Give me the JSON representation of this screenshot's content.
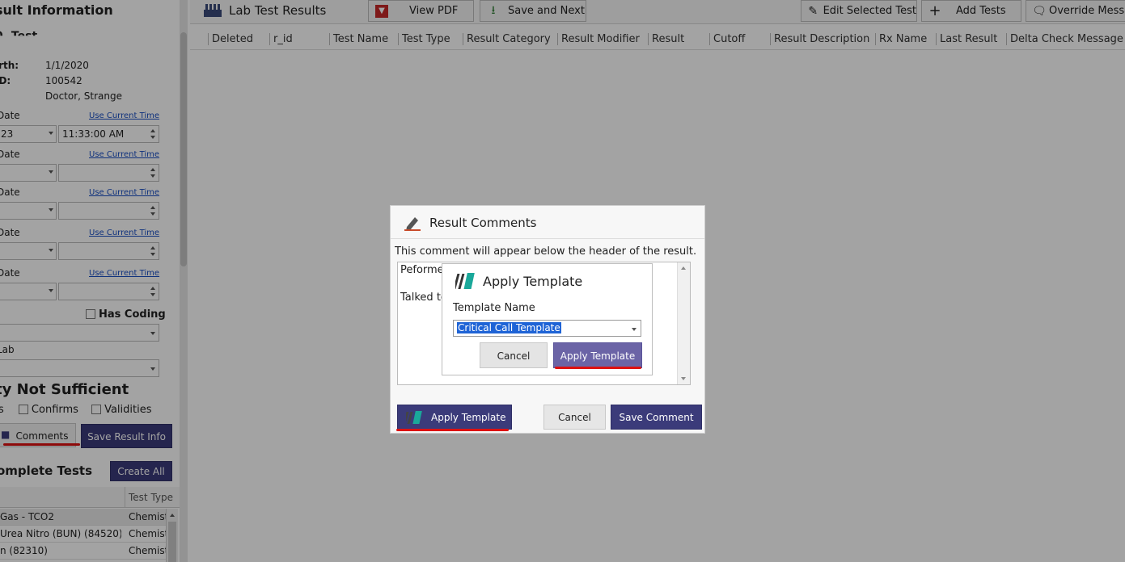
{
  "left_panel": {
    "title": "sult Information",
    "subtitle": "0. Test",
    "info": [
      {
        "key": "irth:",
        "value": "1/1/2020"
      },
      {
        "key": " ID:",
        "value": "100542"
      },
      {
        "key": ":",
        "value": "Doctor, Strange"
      }
    ],
    "dates": [
      {
        "label": "Date",
        "link": "Use Current Time",
        "date_value": "23",
        "time_value": "11:33:00 AM"
      },
      {
        "label": "Date",
        "link": "Use Current Time",
        "date_value": "",
        "time_value": ""
      },
      {
        "label": " Date",
        "link": "Use Current Time",
        "date_value": "",
        "time_value": ""
      },
      {
        "label": " Date",
        "link": "Use Current Time",
        "date_value": "",
        "time_value": ""
      },
      {
        "label": " Date",
        "link": "Use Current Time",
        "date_value": "",
        "time_value": ""
      }
    ],
    "has_coding": "Has Coding",
    "lab_label": " Lab",
    "status_heading": "ty Not Sufficient",
    "checks": [
      "s",
      "Confirms",
      "Validities"
    ],
    "comments_button": "Comments",
    "save_result_button": "Save Result Info",
    "incomplete_title": "omplete Tests",
    "create_all_button": "Create All",
    "table_header_test_type": "Test Type",
    "table_rows": [
      {
        "name": "Gas - TCO2",
        "type": "Chemist"
      },
      {
        "name": "Urea Nitro (BUN) (84520)",
        "type": "Chemist"
      },
      {
        "name": "n (82310)",
        "type": "Chemist"
      }
    ]
  },
  "main": {
    "title": "Lab Test Results",
    "toolbar": {
      "view_pdf": "View PDF",
      "save_next": "Save and Next",
      "edit_selected": "Edit Selected Test",
      "add_tests": "Add Tests",
      "override": "Override Messa"
    },
    "columns": [
      "Deleted",
      "r_id",
      "Test Name",
      "Test Type",
      "Result Category",
      "Result Modifier",
      "Result",
      "Cutoff",
      "Result Description",
      "Rx Name",
      "Last Result",
      "Delta Check Message"
    ]
  },
  "result_comments": {
    "title": "Result Comments",
    "hint": "This comment will appear below the header of the result.",
    "text_line1": "Peforme",
    "text_line2": "Talked to",
    "apply_template_button": "Apply Template",
    "cancel_button": "Cancel",
    "save_comment_button": "Save Comment"
  },
  "apply_template": {
    "title": "Apply Template",
    "label": "Template Name",
    "selected_value": "Critical Call Template",
    "cancel_button": "Cancel",
    "apply_button": "Apply Template"
  },
  "colors": {
    "accent_dark": "#3b3b7a",
    "apply_button": "#6b64a6",
    "highlight_red": "#d11111",
    "selection_blue": "#1e63d6"
  }
}
